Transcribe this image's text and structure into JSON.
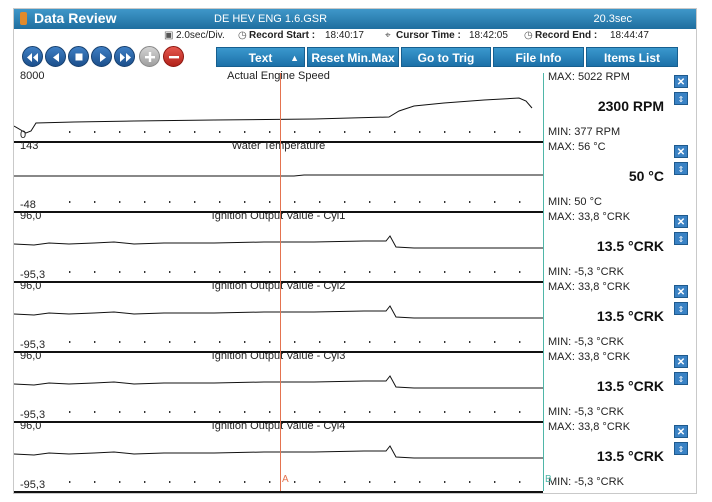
{
  "window": {
    "title": "Data Review",
    "file_name": "DE HEV ENG 1.6.GSR",
    "duration": "20.3sec"
  },
  "info": {
    "time_div": "2.0sec/Div.",
    "record_start_label": "Record Start :",
    "record_start": "18:40:17",
    "cursor_time_label": "Cursor Time :",
    "cursor_time": "18:42:05",
    "record_end_label": "Record End :",
    "record_end": "18:44:47"
  },
  "toolbar": {
    "text_label": "Text",
    "reset_label": "Reset Min.Max",
    "goto_label": "Go to Trig",
    "fileinfo_label": "File Info",
    "items_label": "Items List"
  },
  "cursors": {
    "a_label": "A",
    "b_label": "B"
  },
  "panels": [
    {
      "name": "Actual Engine Speed",
      "scale_max": "8000",
      "scale_min": "0",
      "max_text": "MAX:  5022 RPM",
      "current": "2300 RPM",
      "min_text": "MIN:   377 RPM",
      "trace": [
        [
          0,
          53
        ],
        [
          12,
          60
        ],
        [
          17,
          58
        ],
        [
          22,
          50
        ],
        [
          60,
          49
        ],
        [
          120,
          48
        ],
        [
          200,
          47
        ],
        [
          300,
          46
        ],
        [
          375,
          44
        ],
        [
          385,
          38
        ],
        [
          400,
          33
        ],
        [
          430,
          30
        ],
        [
          470,
          27
        ],
        [
          505,
          25
        ],
        [
          512,
          28
        ],
        [
          518,
          35
        ]
      ]
    },
    {
      "name": "Water Temperature",
      "scale_max": "143",
      "scale_min": "-48",
      "max_text": "MAX:    56 °C",
      "current": "50 °C",
      "min_text": "MIN:    50 °C",
      "trace": [
        [
          0,
          33
        ],
        [
          280,
          33
        ],
        [
          290,
          32
        ],
        [
          529,
          32
        ]
      ]
    },
    {
      "name": "Ignition Output Value - Cyl1",
      "scale_max": "96,0",
      "scale_min": "-95,3",
      "max_text": "MAX:  33,8 °CRK",
      "current": "13.5 °CRK",
      "min_text": "MIN:  -5,3 °CRK",
      "trace": [
        [
          0,
          31
        ],
        [
          20,
          32
        ],
        [
          35,
          30
        ],
        [
          55,
          31
        ],
        [
          80,
          30
        ],
        [
          100,
          29
        ],
        [
          120,
          31
        ],
        [
          150,
          30
        ],
        [
          200,
          30
        ],
        [
          250,
          29
        ],
        [
          300,
          29
        ],
        [
          350,
          28
        ],
        [
          372,
          28
        ],
        [
          376,
          23
        ],
        [
          382,
          34
        ],
        [
          400,
          35
        ],
        [
          450,
          35
        ],
        [
          529,
          35
        ]
      ]
    },
    {
      "name": "Ignition Output Value - Cyl2",
      "scale_max": "96,0",
      "scale_min": "-95,3",
      "max_text": "MAX:  33,8 °CRK",
      "current": "13.5 °CRK",
      "min_text": "MIN:  -5,3 °CRK",
      "trace": [
        [
          0,
          31
        ],
        [
          20,
          32
        ],
        [
          35,
          30
        ],
        [
          55,
          31
        ],
        [
          80,
          30
        ],
        [
          100,
          29
        ],
        [
          120,
          31
        ],
        [
          150,
          30
        ],
        [
          200,
          30
        ],
        [
          250,
          29
        ],
        [
          300,
          29
        ],
        [
          350,
          28
        ],
        [
          372,
          28
        ],
        [
          376,
          23
        ],
        [
          382,
          34
        ],
        [
          400,
          35
        ],
        [
          450,
          35
        ],
        [
          529,
          35
        ]
      ]
    },
    {
      "name": "Ignition Output Value - Cyl3",
      "scale_max": "96,0",
      "scale_min": "-95,3",
      "max_text": "MAX:  33,8 °CRK",
      "current": "13.5 °CRK",
      "min_text": "MIN:  -5,3 °CRK",
      "trace": [
        [
          0,
          31
        ],
        [
          20,
          32
        ],
        [
          35,
          30
        ],
        [
          55,
          31
        ],
        [
          80,
          30
        ],
        [
          100,
          29
        ],
        [
          120,
          31
        ],
        [
          150,
          30
        ],
        [
          200,
          30
        ],
        [
          250,
          29
        ],
        [
          300,
          29
        ],
        [
          350,
          28
        ],
        [
          372,
          28
        ],
        [
          376,
          23
        ],
        [
          382,
          34
        ],
        [
          400,
          35
        ],
        [
          450,
          35
        ],
        [
          529,
          35
        ]
      ]
    },
    {
      "name": "Ignition Output Value - Cyl4",
      "scale_max": "96,0",
      "scale_min": "-95,3",
      "max_text": "MAX:  33,8 °CRK",
      "current": "13.5 °CRK",
      "min_text": "MIN:  -5,3 °CRK",
      "trace": [
        [
          0,
          31
        ],
        [
          20,
          32
        ],
        [
          35,
          30
        ],
        [
          55,
          31
        ],
        [
          80,
          30
        ],
        [
          100,
          29
        ],
        [
          120,
          31
        ],
        [
          150,
          30
        ],
        [
          200,
          30
        ],
        [
          250,
          29
        ],
        [
          300,
          29
        ],
        [
          350,
          28
        ],
        [
          372,
          28
        ],
        [
          376,
          23
        ],
        [
          382,
          34
        ],
        [
          400,
          35
        ],
        [
          450,
          35
        ],
        [
          529,
          35
        ]
      ]
    }
  ],
  "colors": {
    "accent": "#1c70a8",
    "cursor_a": "#e4734f",
    "cursor_b": "#4fb6a8",
    "trace": "#111111"
  }
}
